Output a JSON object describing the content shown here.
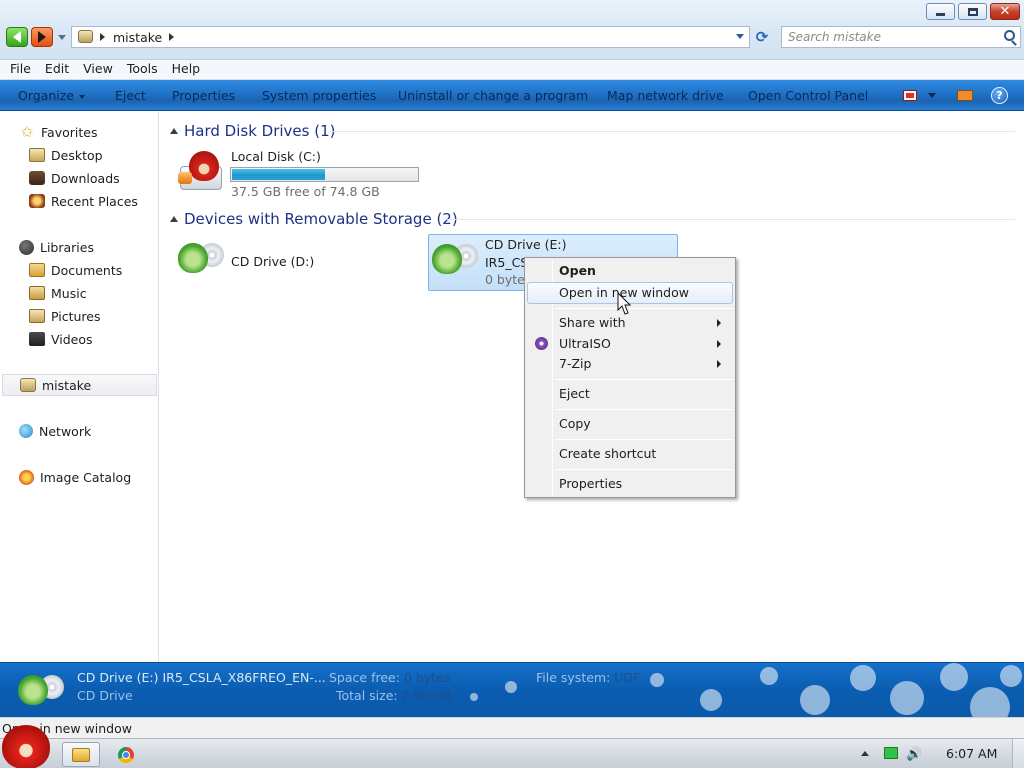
{
  "window": {
    "minimize_icon": "minimize-icon",
    "maximize_icon": "restore-icon",
    "close_icon": "close-icon"
  },
  "address": {
    "location": "mistake",
    "search_placeholder": "Search mistake"
  },
  "menubar": [
    "File",
    "Edit",
    "View",
    "Tools",
    "Help"
  ],
  "commandbar": {
    "organize": "Organize",
    "eject": "Eject",
    "properties": "Properties",
    "system_properties": "System properties",
    "uninstall": "Uninstall or change a program",
    "map_drive": "Map network drive",
    "control_panel": "Open Control Panel"
  },
  "sidebar": {
    "favorites": "Favorites",
    "desktop": "Desktop",
    "downloads": "Downloads",
    "recent": "Recent Places",
    "libraries": "Libraries",
    "documents": "Documents",
    "music": "Music",
    "pictures": "Pictures",
    "videos": "Videos",
    "computer": "mistake",
    "network": "Network",
    "image_catalog": "Image Catalog"
  },
  "groups": {
    "hdd": "Hard Disk Drives (1)",
    "removable": "Devices with Removable Storage (2)"
  },
  "drives": {
    "c": {
      "name": "Local Disk (C:)",
      "free": "37.5 GB free of 74.8 GB",
      "used_fraction": 0.5
    },
    "d": {
      "name": "CD Drive (D:)"
    },
    "e": {
      "name": "CD Drive (E:)",
      "label": "IR5_CS",
      "bytes": "0 bytes"
    }
  },
  "context_menu": {
    "open": "Open",
    "open_new_window": "Open in new window",
    "share_with": "Share with",
    "ultraiso": "UltraISO",
    "zip": "7-Zip",
    "eject": "Eject",
    "copy": "Copy",
    "create_shortcut": "Create shortcut",
    "properties": "Properties"
  },
  "details": {
    "title": "CD Drive (E:) IR5_CSLA_X86FREO_EN-...",
    "type": "CD Drive",
    "space_free_label": "Space free:",
    "space_free_value": "0 bytes",
    "total_size_label": "Total size:",
    "total_size_value": "2.90 GB",
    "fs_label": "File system:",
    "fs_value": "UDF"
  },
  "statusbar": {
    "text": "Open in new window"
  },
  "taskbar": {
    "time": "6:07 AM"
  }
}
